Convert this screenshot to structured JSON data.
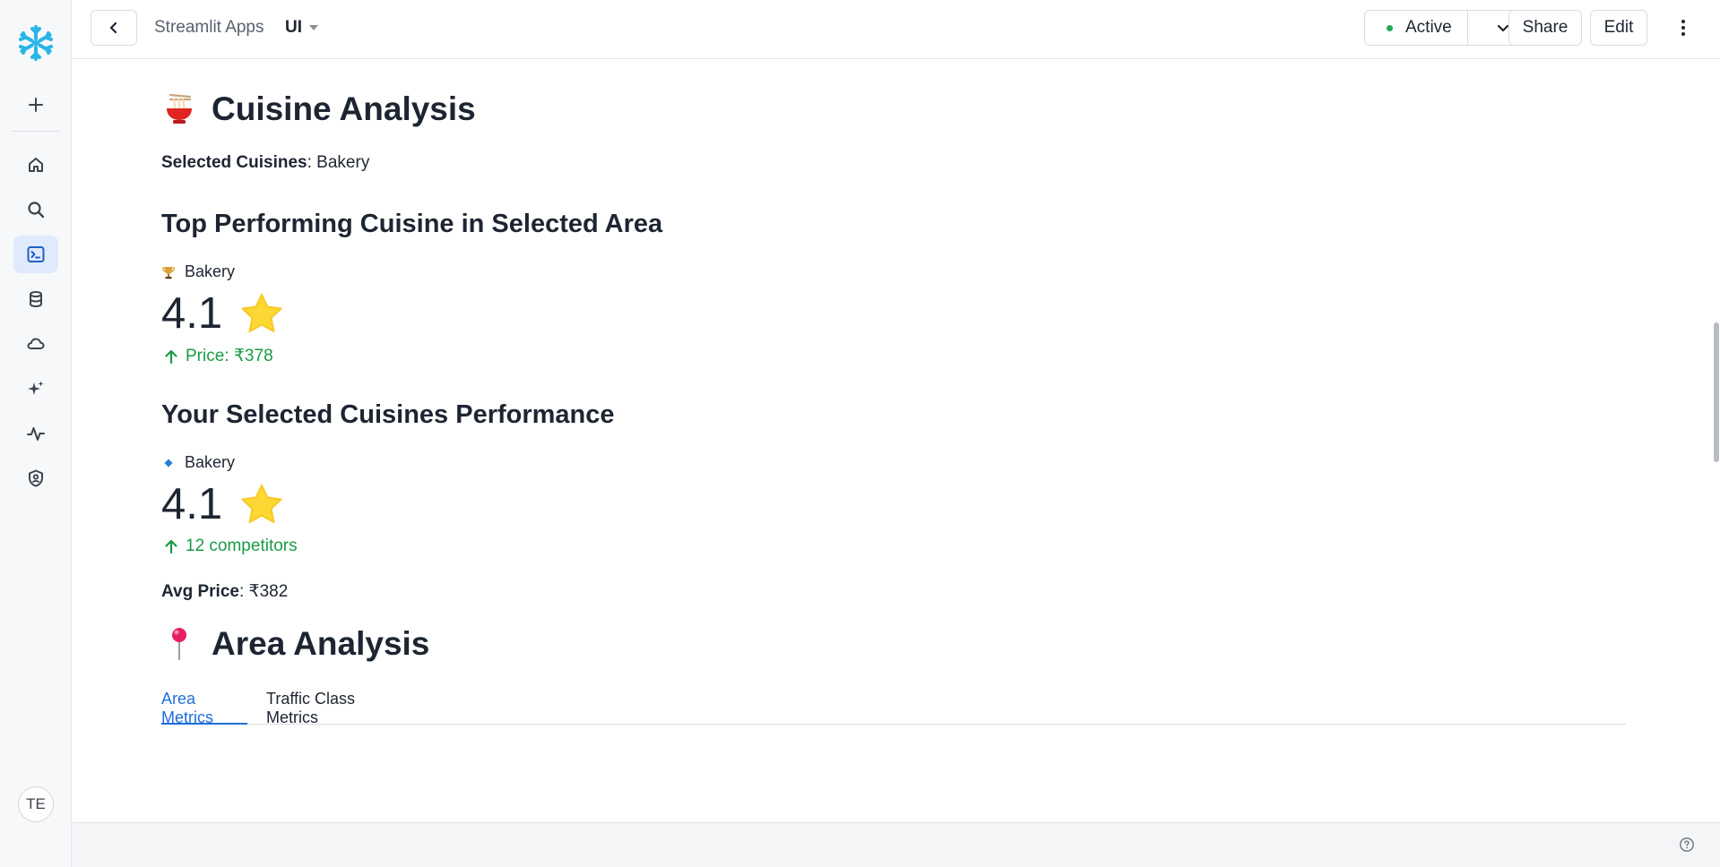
{
  "nav": {
    "logo": "snowflake-logo",
    "items": [
      {
        "name": "add",
        "icon": "plus-icon"
      },
      {
        "name": "home",
        "icon": "home-icon"
      },
      {
        "name": "search",
        "icon": "search-icon"
      },
      {
        "name": "projects",
        "icon": "terminal-icon",
        "active": true
      },
      {
        "name": "data",
        "icon": "database-icon"
      },
      {
        "name": "cloud",
        "icon": "cloud-icon"
      },
      {
        "name": "ai",
        "icon": "sparkle-icon"
      },
      {
        "name": "monitoring",
        "icon": "activity-icon"
      },
      {
        "name": "admin",
        "icon": "shield-icon"
      }
    ],
    "avatar_initials": "TE"
  },
  "header": {
    "breadcrumb": "Streamlit Apps",
    "app_name": "UI",
    "status_label": "Active",
    "share_label": "Share",
    "edit_label": "Edit"
  },
  "cuisine": {
    "title": "Cuisine Analysis",
    "selected_label": "Selected Cuisines",
    "selected_value": ": Bakery",
    "top_heading": "Top Performing Cuisine in Selected Area",
    "top_name": "Bakery",
    "top_rating": "4.1",
    "top_delta": "Price: ₹378",
    "yours_heading": "Your Selected Cuisines Performance",
    "yours_name": "Bakery",
    "yours_rating": "4.1",
    "yours_delta": "12 competitors",
    "avg_price_label": "Avg Price",
    "avg_price_value": ": ₹382"
  },
  "area": {
    "title": "Area Analysis",
    "tabs": [
      {
        "label": "Area Metrics",
        "active": true
      },
      {
        "label": "Traffic Class Metrics",
        "active": false
      }
    ]
  },
  "colors": {
    "accent": "#1f6fd9",
    "positive": "#1a9b45",
    "status_dot": "#22a85a",
    "logo": "#29b5e8"
  }
}
